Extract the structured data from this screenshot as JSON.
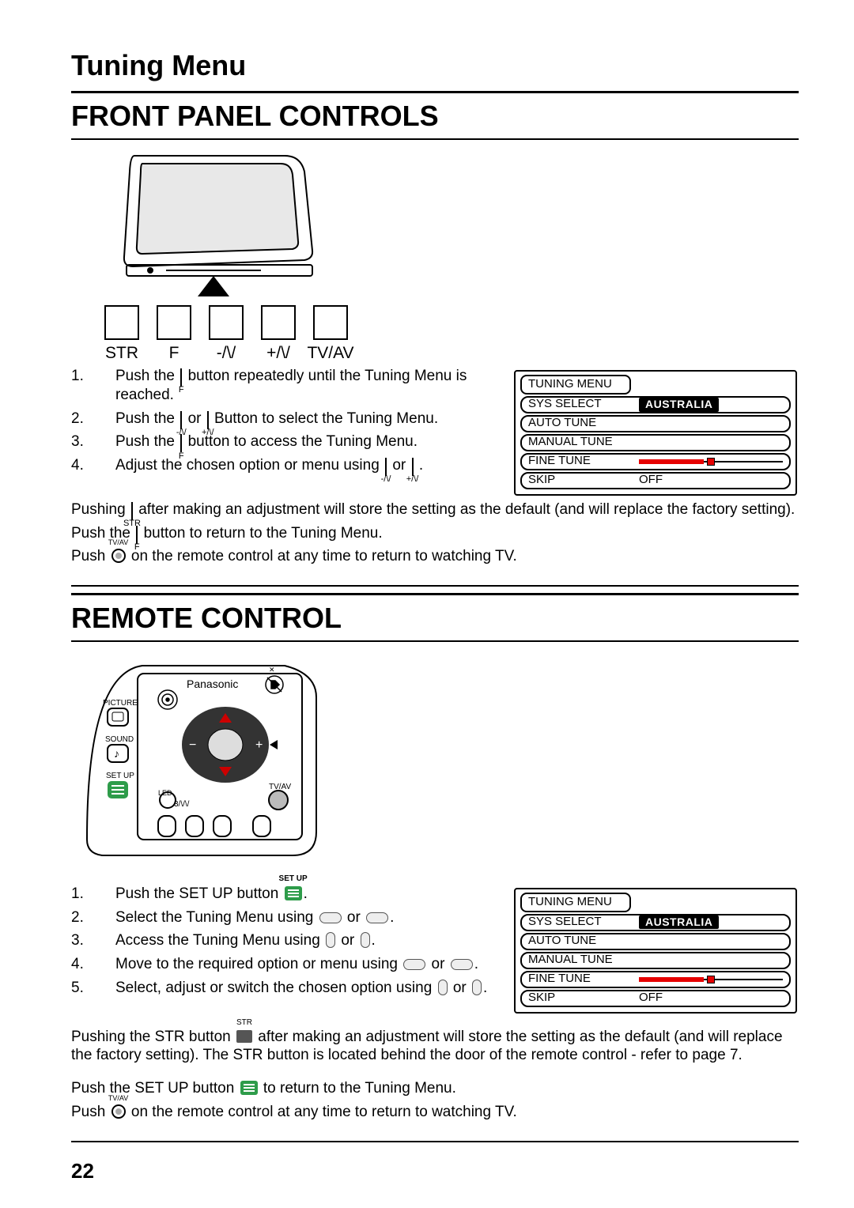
{
  "page_number": "22",
  "title": "Tuning Menu",
  "sections": {
    "front_panel": {
      "heading": "FRONT PANEL CONTROLS",
      "buttons": [
        "STR",
        "F",
        "-/\\/",
        "+/\\/",
        "TV/AV"
      ],
      "steps": [
        {
          "n": "1.",
          "pre": "Push the ",
          "icon_sub": "F",
          "post": " button repeatedly until the Tuning Menu is reached."
        },
        {
          "n": "2.",
          "pre": "Push the ",
          "icon_sub": "-/\\/",
          "mid": " or ",
          "icon_sub2": "+/\\/",
          "post": " Button to select the Tuning Menu."
        },
        {
          "n": "3.",
          "pre": "Push the ",
          "icon_sub": "F",
          "post": " button to access the Tuning Menu."
        },
        {
          "n": "4.",
          "pre": "Adjust the chosen option or menu using ",
          "icon_sub": "-/\\/",
          "mid": " or ",
          "icon_sub2": "+/\\/",
          "post": "."
        }
      ],
      "para1_pre": "Pushing ",
      "para1_icon_sub": "STR",
      "para1_post": " after making an adjustment will store the setting as the default (and will replace the factory setting).",
      "para2_pre": "Push the ",
      "para2_icon_sub": "F",
      "para2_post": " button to return to the Tuning Menu.",
      "para3_pre": "Push ",
      "para3_label": "TV/AV",
      "para3_post": " on the remote control at any time to return to watching TV."
    },
    "remote": {
      "heading": "REMOTE CONTROL",
      "brand": "Panasonic",
      "side_labels": [
        "PICTURE",
        "SOUND",
        "SET UP"
      ],
      "bottom_labels_left": "3/\\/\\/",
      "bottom_label_right": "TV/AV",
      "led_label": "LED",
      "steps": [
        {
          "n": "1.",
          "text_pre": "Push the SET UP button ",
          "icon": "setup",
          "icon_label": "SET UP",
          "text_post": "."
        },
        {
          "n": "2.",
          "text_pre": "Select the Tuning Menu using ",
          "icon": "oval",
          "text_mid": " or ",
          "icon2": "oval",
          "text_post": "."
        },
        {
          "n": "3.",
          "text_pre": "Access the Tuning Menu using ",
          "icon": "vol",
          "text_mid": " or ",
          "icon2": "vol",
          "text_post": "."
        },
        {
          "n": "4.",
          "text_pre": "Move to the required option or menu using ",
          "icon": "oval",
          "text_mid": " or ",
          "icon2": "oval",
          "text_post": "."
        },
        {
          "n": "5.",
          "text_pre": "Select, adjust or switch the chosen option using ",
          "icon": "vol",
          "text_mid": " or ",
          "icon2": "vol",
          "text_post": "."
        }
      ],
      "para1_pre": "Pushing the STR button ",
      "para1_icon_label": "STR",
      "para1_post": " after making an adjustment will store the setting as the default (and will replace the factory setting). The STR button is located behind the door of the remote control - refer to page 7.",
      "para2_pre": "Push the SET UP button ",
      "para2_post": " to return to the Tuning Menu.",
      "para3_pre": "Push ",
      "para3_label": "TV/AV",
      "para3_post": "  on the remote control at any time to return to watching TV."
    }
  },
  "osd": {
    "title": "TUNING MENU",
    "rows": [
      {
        "label": "SYS SELECT",
        "value": "AUSTRALIA",
        "type": "dark"
      },
      {
        "label": "AUTO TUNE",
        "type": "blank"
      },
      {
        "label": "MANUAL TUNE",
        "type": "blank"
      },
      {
        "label": "FINE TUNE",
        "type": "slider"
      },
      {
        "label": "SKIP",
        "value": "OFF",
        "type": "text"
      }
    ]
  }
}
